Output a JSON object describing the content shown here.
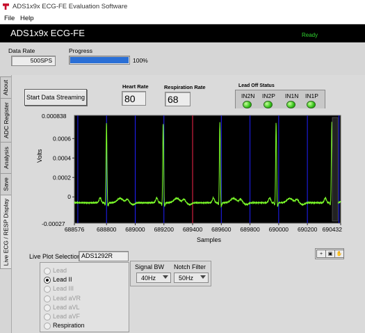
{
  "window": {
    "title": "ADS1x9x ECG-FE Evaluation Software"
  },
  "menu": {
    "file": "File",
    "help": "Help"
  },
  "banner": {
    "app_name": "ADS1x9x ECG-FE",
    "status": "Ready"
  },
  "top": {
    "data_rate_label": "Data Rate",
    "data_rate_value": "500SPS",
    "progress_label": "Progress",
    "progress_percent": "100%",
    "progress_fraction": 1.0
  },
  "tabs": [
    "Live ECG / RESP Display",
    "Save",
    "Analysis",
    "ADC Register",
    "About"
  ],
  "controls": {
    "start_button": "Start  Data Streaming",
    "heart_rate_label": "Heart Rate",
    "heart_rate_value": "80",
    "respiration_rate_label": "Respiration Rate",
    "respiration_rate_value": "68"
  },
  "lead_off": {
    "title": "Lead Off Status",
    "channels": [
      "IN2N",
      "IN2P",
      "IN1N",
      "IN1P"
    ]
  },
  "chart_data": {
    "type": "line",
    "xlabel": "Samples",
    "ylabel": "Volts",
    "y_top_label": "0.000838",
    "y_bottom_label": "-0.00027",
    "xlim": [
      688576,
      690432
    ],
    "ylim": [
      -0.00027,
      0.000838
    ],
    "x_ticks": [
      "688576",
      "688800",
      "689000",
      "689200",
      "689400",
      "689600",
      "689800",
      "690000",
      "690200",
      "690432"
    ],
    "y_ticks": [
      "0.0006",
      "0.0004",
      "0.0002",
      "0"
    ],
    "y_tick_values": [
      0.0006,
      0.0004,
      0.0002,
      0
    ],
    "x_tick_values": [
      688576,
      688800,
      689000,
      689200,
      689400,
      689600,
      689800,
      690000,
      690200,
      690432
    ],
    "series": [
      {
        "color": "#7dff2a",
        "r_peaks": [
          688800,
          689195,
          689590,
          689982,
          690370
        ],
        "baseline": -6e-05,
        "r_amplitude": 0.00083,
        "t_amplitude": 4.5e-05,
        "s_depth": -4.5e-05
      }
    ],
    "markers_blue_x": [
      688600,
      688800,
      689000,
      689200,
      689400,
      689600,
      689800,
      690000,
      690200,
      690420
    ],
    "marker_red_x": 689400,
    "colors": {
      "background": "#000000",
      "trace": "#7dff2a",
      "marker": "#2020ff",
      "marker_red": "#d0203a"
    }
  },
  "plot_selection": {
    "label": "Live Plot Selection",
    "device": "ADS1292R",
    "options": [
      {
        "label": "Lead",
        "enabled": false,
        "selected": false
      },
      {
        "label": "Lead II",
        "enabled": true,
        "selected": true
      },
      {
        "label": "Lead III",
        "enabled": false,
        "selected": false
      },
      {
        "label": "Lead aVR",
        "enabled": false,
        "selected": false
      },
      {
        "label": "Lead aVL",
        "enabled": false,
        "selected": false
      },
      {
        "label": "Lead aVF",
        "enabled": false,
        "selected": false
      },
      {
        "label": "Respiration",
        "enabled": true,
        "selected": false
      }
    ]
  },
  "filters": {
    "signal_bw_label": "Signal BW",
    "signal_bw_value": "40Hz",
    "notch_label": "Notch Filter",
    "notch_value": "50Hz"
  }
}
